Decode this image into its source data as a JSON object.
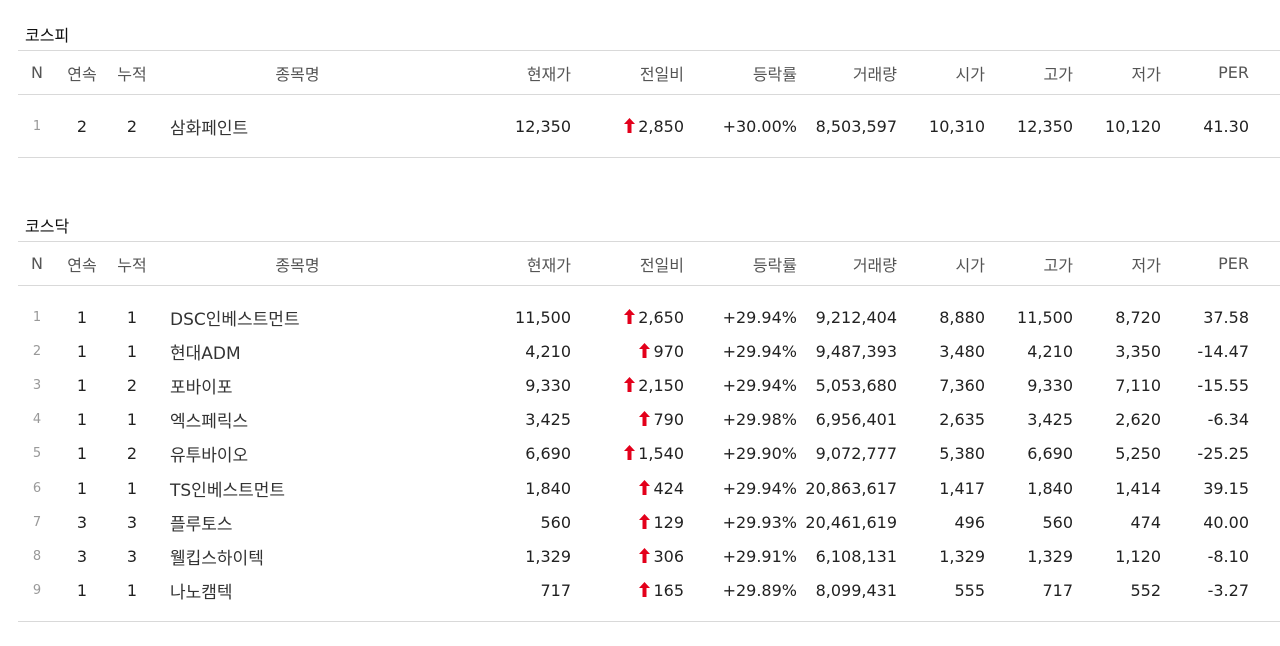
{
  "headers": {
    "n": "N",
    "consecutive": "연속",
    "cumulative": "누적",
    "name": "종목명",
    "price": "현재가",
    "change": "전일비",
    "rate": "등락률",
    "volume": "거래량",
    "open": "시가",
    "high": "고가",
    "low": "저가",
    "per": "PER"
  },
  "colors": {
    "up": "#e3001b",
    "border": "#d9d9d9"
  },
  "icons": {
    "up_arrow": "up-arrow-icon"
  },
  "sections": [
    {
      "title": "코스피",
      "rows": [
        {
          "n": "1",
          "consecutive": "2",
          "cumulative": "2",
          "name": "삼화페인트",
          "price": "12,350",
          "change": "2,850",
          "rate": "+30.00%",
          "volume": "8,503,597",
          "open": "10,310",
          "high": "12,350",
          "low": "10,120",
          "per": "41.30"
        }
      ]
    },
    {
      "title": "코스닥",
      "rows": [
        {
          "n": "1",
          "consecutive": "1",
          "cumulative": "1",
          "name": "DSC인베스트먼트",
          "price": "11,500",
          "change": "2,650",
          "rate": "+29.94%",
          "volume": "9,212,404",
          "open": "8,880",
          "high": "11,500",
          "low": "8,720",
          "per": "37.58"
        },
        {
          "n": "2",
          "consecutive": "1",
          "cumulative": "1",
          "name": "현대ADM",
          "price": "4,210",
          "change": "970",
          "rate": "+29.94%",
          "volume": "9,487,393",
          "open": "3,480",
          "high": "4,210",
          "low": "3,350",
          "per": "-14.47"
        },
        {
          "n": "3",
          "consecutive": "1",
          "cumulative": "2",
          "name": "포바이포",
          "price": "9,330",
          "change": "2,150",
          "rate": "+29.94%",
          "volume": "5,053,680",
          "open": "7,360",
          "high": "9,330",
          "low": "7,110",
          "per": "-15.55"
        },
        {
          "n": "4",
          "consecutive": "1",
          "cumulative": "1",
          "name": "엑스페릭스",
          "price": "3,425",
          "change": "790",
          "rate": "+29.98%",
          "volume": "6,956,401",
          "open": "2,635",
          "high": "3,425",
          "low": "2,620",
          "per": "-6.34"
        },
        {
          "n": "5",
          "consecutive": "1",
          "cumulative": "2",
          "name": "유투바이오",
          "price": "6,690",
          "change": "1,540",
          "rate": "+29.90%",
          "volume": "9,072,777",
          "open": "5,380",
          "high": "6,690",
          "low": "5,250",
          "per": "-25.25"
        },
        {
          "n": "6",
          "consecutive": "1",
          "cumulative": "1",
          "name": "TS인베스트먼트",
          "price": "1,840",
          "change": "424",
          "rate": "+29.94%",
          "volume": "20,863,617",
          "open": "1,417",
          "high": "1,840",
          "low": "1,414",
          "per": "39.15"
        },
        {
          "n": "7",
          "consecutive": "3",
          "cumulative": "3",
          "name": "플루토스",
          "price": "560",
          "change": "129",
          "rate": "+29.93%",
          "volume": "20,461,619",
          "open": "496",
          "high": "560",
          "low": "474",
          "per": "40.00"
        },
        {
          "n": "8",
          "consecutive": "3",
          "cumulative": "3",
          "name": "웰킵스하이텍",
          "price": "1,329",
          "change": "306",
          "rate": "+29.91%",
          "volume": "6,108,131",
          "open": "1,329",
          "high": "1,329",
          "low": "1,120",
          "per": "-8.10"
        },
        {
          "n": "9",
          "consecutive": "1",
          "cumulative": "1",
          "name": "나노캠텍",
          "price": "717",
          "change": "165",
          "rate": "+29.89%",
          "volume": "8,099,431",
          "open": "555",
          "high": "717",
          "low": "552",
          "per": "-3.27"
        }
      ]
    }
  ]
}
